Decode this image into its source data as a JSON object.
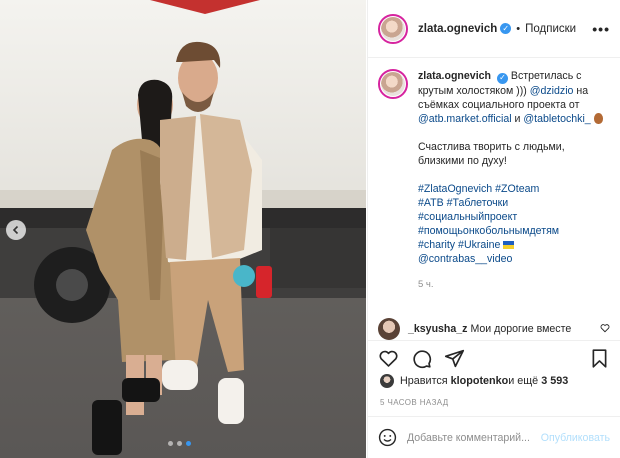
{
  "photo": {
    "alt": "",
    "carousel": {
      "total": 3,
      "active_index": 2
    }
  },
  "header": {
    "username": "zlata.ognevich",
    "verified_icon": "verified-badge-icon",
    "separator": "•",
    "follow_label": "Подписки",
    "more_icon": "more-options-icon"
  },
  "caption": {
    "username": "zlata.ognevich",
    "text_1": "Встретилась с крутым холостяком ))) ",
    "mention_1": "@dzidzio",
    "text_2": " на съёмках социального проекта от ",
    "mention_2": "@atb.market.official",
    "text_3": " и ",
    "mention_3": "@tabletochki_",
    "paragraph_2": "Счастлива творить с людьми, близкими по духу!",
    "hashtags": [
      "#ZlataOgnevich",
      "#ZOteam",
      "#АТВ",
      "#Таблеточки",
      "#социальныйпроект",
      "#помощьонкобольнымдетям",
      "#charity",
      "#Ukraine",
      "@contrabas__video"
    ],
    "time": "5 ч."
  },
  "comment": {
    "username": "_ksyusha_z",
    "text": "Мои дорогие вместе"
  },
  "actions": {
    "like_icon": "heart-icon",
    "comment_icon": "comment-icon",
    "share_icon": "share-icon",
    "save_icon": "bookmark-icon"
  },
  "likes": {
    "prefix": "Нравится ",
    "user": "klopotenko",
    "middle": " и ещё ",
    "count": "3 593"
  },
  "timestamp": "5 ЧАСОВ НАЗАД",
  "add_comment": {
    "placeholder": "Добавьте комментарий...",
    "publish_label": "Опубликовать",
    "emoji_icon": "emoji-icon"
  },
  "colors": {
    "link": "#0b4a8a",
    "verified": "#3897f0",
    "muted": "#8e8e8e",
    "publish_disabled": "#b2dffc"
  }
}
